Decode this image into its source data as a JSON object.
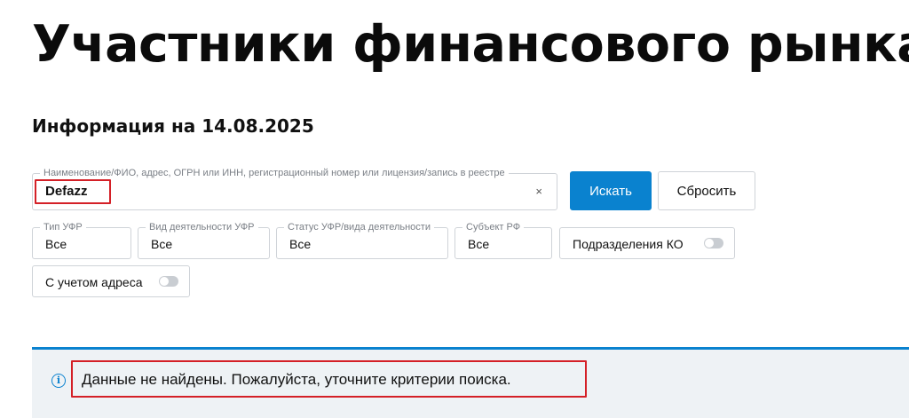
{
  "page": {
    "title": "Участники финансового рынка",
    "info_date": "Информация на 14.08.2025"
  },
  "search": {
    "label": "Наименование/ФИО, адрес, ОГРН или ИНН, регистрационный номер или лицензия/запись в реестре",
    "value": "Defazz",
    "clear_icon": "×",
    "search_button": "Искать",
    "reset_button": "Сбросить"
  },
  "filters": {
    "type": {
      "label": "Тип УФР",
      "value": "Все"
    },
    "activity": {
      "label": "Вид деятельности УФР",
      "value": "Все"
    },
    "status": {
      "label": "Статус УФР/вида деятельности",
      "value": "Все"
    },
    "region": {
      "label": "Субъект РФ",
      "value": "Все"
    },
    "ko_divisions": {
      "label": "Подразделения КО",
      "enabled": false
    },
    "with_address": {
      "label": "С учетом адреса",
      "enabled": false
    }
  },
  "result": {
    "message": "Данные не найдены. Пожалуйста, уточните критерии поиска.",
    "icon": "info-icon"
  },
  "colors": {
    "accent": "#0a82cf",
    "highlight": "#d42027",
    "panel_bg": "#eef2f5"
  }
}
